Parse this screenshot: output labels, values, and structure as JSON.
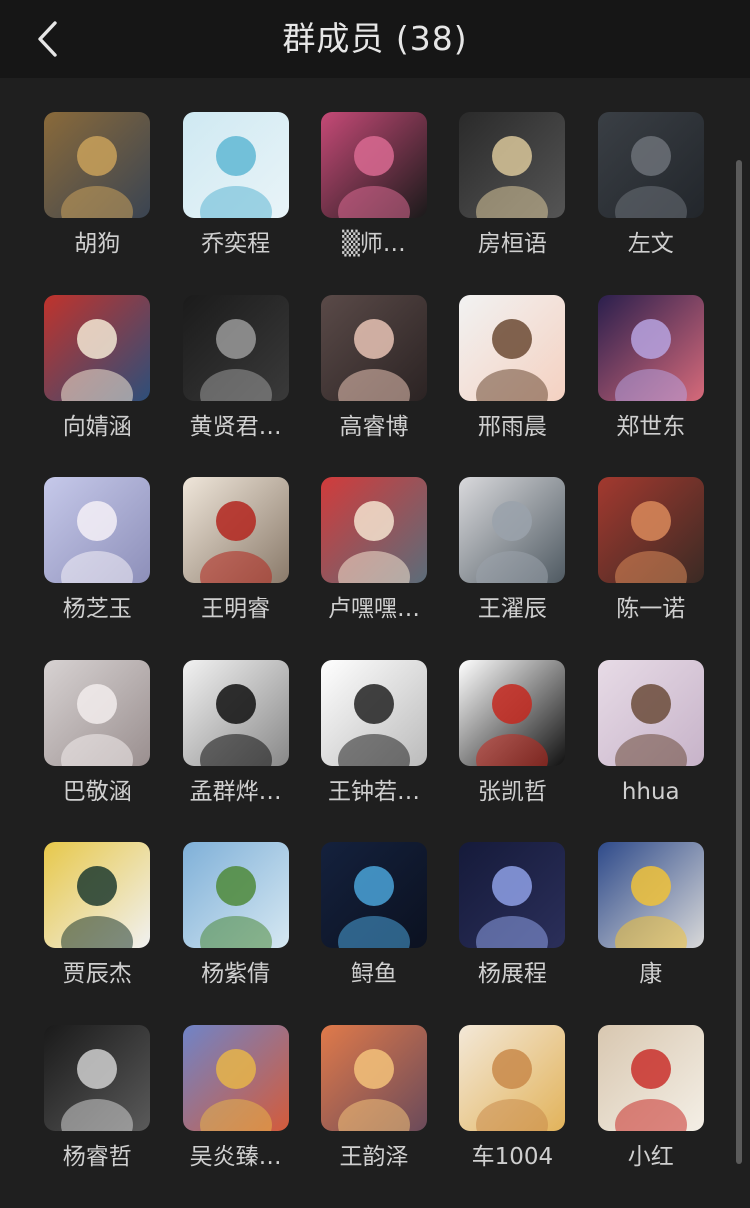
{
  "header": {
    "title": "群成员 (38)",
    "back_icon": "chevron-left-icon"
  },
  "members": [
    {
      "name": "胡狗",
      "colors": [
        "#8a6a3a",
        "#c9a15b",
        "#3a4452"
      ]
    },
    {
      "name": "乔奕程",
      "colors": [
        "#cfe9f2",
        "#5fb7d4",
        "#e9f4f8"
      ]
    },
    {
      "name": "▒师…",
      "colors": [
        "#c64a77",
        "#d96a92",
        "#1a1a1a"
      ]
    },
    {
      "name": "房桓语",
      "colors": [
        "#2a2a2a",
        "#d9c79a",
        "#555555"
      ]
    },
    {
      "name": "左文",
      "colors": [
        "#3a3f45",
        "#6c7178",
        "#22262b"
      ]
    },
    {
      "name": "向婧涵",
      "colors": [
        "#c0332c",
        "#f3e7d3",
        "#2d4f7a"
      ]
    },
    {
      "name": "黄贤君…",
      "colors": [
        "#1b1b1b",
        "#9a9a9a",
        "#3a3a3a"
      ]
    },
    {
      "name": "高睿博",
      "colors": [
        "#5a4a48",
        "#e8c3b5",
        "#2b2323"
      ]
    },
    {
      "name": "邢雨晨",
      "colors": [
        "#f2f2f2",
        "#6b4a34",
        "#f4d1c1"
      ]
    },
    {
      "name": "郑世东",
      "colors": [
        "#2a1f4d",
        "#b7a3e0",
        "#d66a7a"
      ]
    },
    {
      "name": "杨芝玉",
      "colors": [
        "#c6c9ea",
        "#f4f0f7",
        "#8d8fb9"
      ]
    },
    {
      "name": "王明睿",
      "colors": [
        "#efe6da",
        "#b3261e",
        "#8a7a6a"
      ]
    },
    {
      "name": "卢嘿嘿…",
      "colors": [
        "#d23b3b",
        "#f4e3cf",
        "#5b6d7a"
      ]
    },
    {
      "name": "王濯辰",
      "colors": [
        "#d9d9dc",
        "#9aa2ab",
        "#4f5a62"
      ]
    },
    {
      "name": "陈一诺",
      "colors": [
        "#a3392f",
        "#d98a5a",
        "#3a2a24"
      ]
    },
    {
      "name": "巴敬涵",
      "colors": [
        "#d7d2d2",
        "#f2ecec",
        "#9a8f8f"
      ]
    },
    {
      "name": "孟群烨…",
      "colors": [
        "#f2f2f2",
        "#111111",
        "#888888"
      ]
    },
    {
      "name": "王钟若…",
      "colors": [
        "#ffffff",
        "#222222",
        "#bbbbbb"
      ]
    },
    {
      "name": "张凯哲",
      "colors": [
        "#ffffff",
        "#c4281e",
        "#111111"
      ]
    },
    {
      "name": "hhua",
      "colors": [
        "#e7dbe6",
        "#6b4b3a",
        "#c7b3c9"
      ]
    },
    {
      "name": "贾辰杰",
      "colors": [
        "#e7c84a",
        "#1f3b2f",
        "#f1f1f1"
      ]
    },
    {
      "name": "杨紫倩",
      "colors": [
        "#7fb0d8",
        "#4f8a3a",
        "#d6e8f2"
      ]
    },
    {
      "name": "鲟鱼",
      "colors": [
        "#14213d",
        "#4aa3d8",
        "#0b1120"
      ]
    },
    {
      "name": "杨展程",
      "colors": [
        "#151a3a",
        "#8ea0e6",
        "#2b2f5a"
      ]
    },
    {
      "name": "康",
      "colors": [
        "#2e4a8a",
        "#f0c23a",
        "#d9d9d9"
      ]
    },
    {
      "name": "杨睿哲",
      "colors": [
        "#1a1a1a",
        "#cfcfcf",
        "#5a5a5a"
      ]
    },
    {
      "name": "吴炎臻…",
      "colors": [
        "#6f84c8",
        "#e6b54a",
        "#d45b3a"
      ]
    },
    {
      "name": "王韵泽",
      "colors": [
        "#e07a4a",
        "#f3c27a",
        "#6a4a5a"
      ]
    },
    {
      "name": "车1004",
      "colors": [
        "#f3e8d8",
        "#c98a4a",
        "#e2b35a"
      ]
    },
    {
      "name": "小红",
      "colors": [
        "#d8c7b0",
        "#c9302c",
        "#f4efe6"
      ]
    }
  ]
}
